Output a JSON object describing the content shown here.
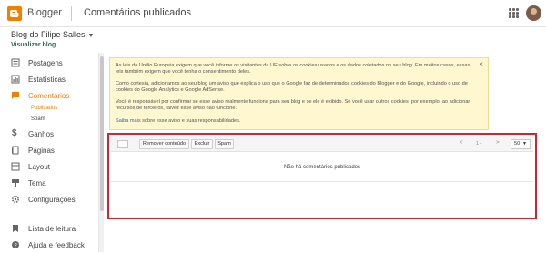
{
  "header": {
    "brand": "Blogger",
    "title": "Comentários publicados",
    "brand_color": "#f57d00"
  },
  "blog": {
    "name": "Blog do Filipe Salles",
    "view_link": "Visualizar blog"
  },
  "sidebar": {
    "items": [
      {
        "label": "Postagens",
        "icon": "posts-icon"
      },
      {
        "label": "Estatísticas",
        "icon": "stats-icon"
      },
      {
        "label": "Comentários",
        "icon": "comments-icon",
        "active": true
      },
      {
        "label": "Ganhos",
        "icon": "earnings-icon"
      },
      {
        "label": "Páginas",
        "icon": "pages-icon"
      },
      {
        "label": "Layout",
        "icon": "layout-icon"
      },
      {
        "label": "Tema",
        "icon": "theme-icon"
      },
      {
        "label": "Configurações",
        "icon": "settings-icon"
      },
      {
        "label": "Lista de leitura",
        "icon": "reading-list-icon"
      },
      {
        "label": "Ajuda e feedback",
        "icon": "help-icon"
      }
    ],
    "sub_items": [
      {
        "label": "Publicados",
        "active": true
      },
      {
        "label": "Spam"
      }
    ]
  },
  "notice": {
    "p1": "As leis da União Europeia exigem que você informe os visitantes da UE sobre os cookies usados e os dados coletados no seu blog. Em muitos casos, essas leis também exigem que você tenha o consentimento deles.",
    "p2": "Como cortesia, adicionamos ao seu blog um aviso que explica o uso que o Google faz de determinados cookies do Blogger e do Google, incluindo o uso de cookies do Google Analytics e Google AdSense.",
    "p3": "Você é responsável por confirmar se esse aviso realmente funciona para seu blog e se ele é exibido. Se você usar outros cookies, por exemplo, ao adicionar recursos de terceiros, talvez esse aviso não funcione.",
    "link": "Saiba mais",
    "p4_rest": " sobre esse aviso e suas responsabilidades.",
    "close": "×"
  },
  "comments": {
    "buttons": {
      "remove": "Remover conteúdo",
      "delete": "Excluir",
      "spam": "Spam"
    },
    "pager": {
      "prev": "<",
      "page": "1 -",
      "next": ">"
    },
    "per_page": "50",
    "empty": "Não há comentários publicados",
    "highlight_color": "#e11d2a"
  }
}
